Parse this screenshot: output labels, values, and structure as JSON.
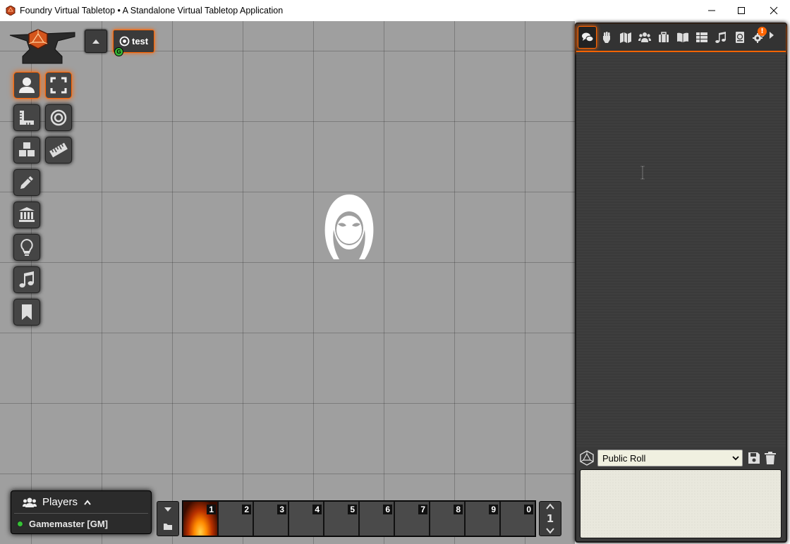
{
  "window": {
    "title": "Foundry Virtual Tabletop • A Standalone Virtual Tabletop Application",
    "controls": [
      "minimize-icon",
      "maximize-icon",
      "close-icon"
    ]
  },
  "navigation": {
    "scene_name": "test",
    "user_badge": "G"
  },
  "scene_controls": [
    {
      "name": "token-controls",
      "icon": "user-icon",
      "active": true
    },
    {
      "name": "toggle-fullscreen",
      "icon": "expand-icon",
      "active": true
    },
    {
      "name": "measure-controls",
      "icon": "ruler-combined-icon",
      "active": false
    },
    {
      "name": "target-tool",
      "icon": "target-icon",
      "active": false
    },
    {
      "name": "tile-controls",
      "icon": "cubes-icon",
      "active": false
    },
    {
      "name": "ruler-tool",
      "icon": "ruler-icon",
      "active": false
    },
    {
      "name": "drawing-controls",
      "icon": "pencil-icon",
      "active": false
    },
    {
      "name": "wall-controls",
      "icon": "landmark-icon",
      "active": false
    },
    {
      "name": "lighting-controls",
      "icon": "lightbulb-icon",
      "active": false
    },
    {
      "name": "sound-controls",
      "icon": "music-icon",
      "active": false
    },
    {
      "name": "notes-controls",
      "icon": "bookmark-icon",
      "active": false
    }
  ],
  "players": {
    "title": "Players",
    "list": [
      {
        "name": "Gamemaster [GM]",
        "online": true
      }
    ]
  },
  "hotbar": {
    "slots": [
      "1",
      "2",
      "3",
      "4",
      "5",
      "6",
      "7",
      "8",
      "9",
      "0"
    ],
    "page": "1"
  },
  "sidebar": {
    "tabs": [
      "chat",
      "combat",
      "scenes",
      "actors",
      "items",
      "journal",
      "tables",
      "playlists",
      "compendium",
      "settings"
    ],
    "notification_badge": "!",
    "roll_mode": "Public Roll"
  },
  "colors": {
    "accent": "#ff6400",
    "canvas": "#9f9f9f",
    "sidebar_bg": "#3a3a3a"
  }
}
